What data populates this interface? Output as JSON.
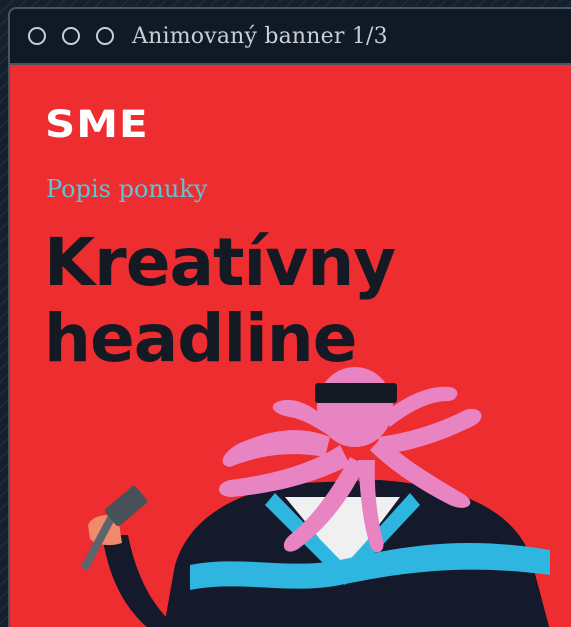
{
  "window": {
    "title": "Animovaný banner 1/3",
    "controls": [
      "close",
      "minimize",
      "maximize"
    ]
  },
  "banner": {
    "logo": "SME",
    "subtitle": "Popis ponuky",
    "headline_line1": "Kreatívny",
    "headline_line2": "headline"
  },
  "illustration": {
    "description_icon": "octopus-head-figure",
    "colors": {
      "background": "#ee2d30",
      "octopus": "#e884c2",
      "body": "#141a2b",
      "scarf": "#2fb6e0",
      "headband": "#141a24",
      "hammer": "#485058"
    }
  },
  "colors": {
    "accent_red": "#ee2d30",
    "subtitle_blue": "#5bc6d8",
    "dark": "#141a24"
  }
}
